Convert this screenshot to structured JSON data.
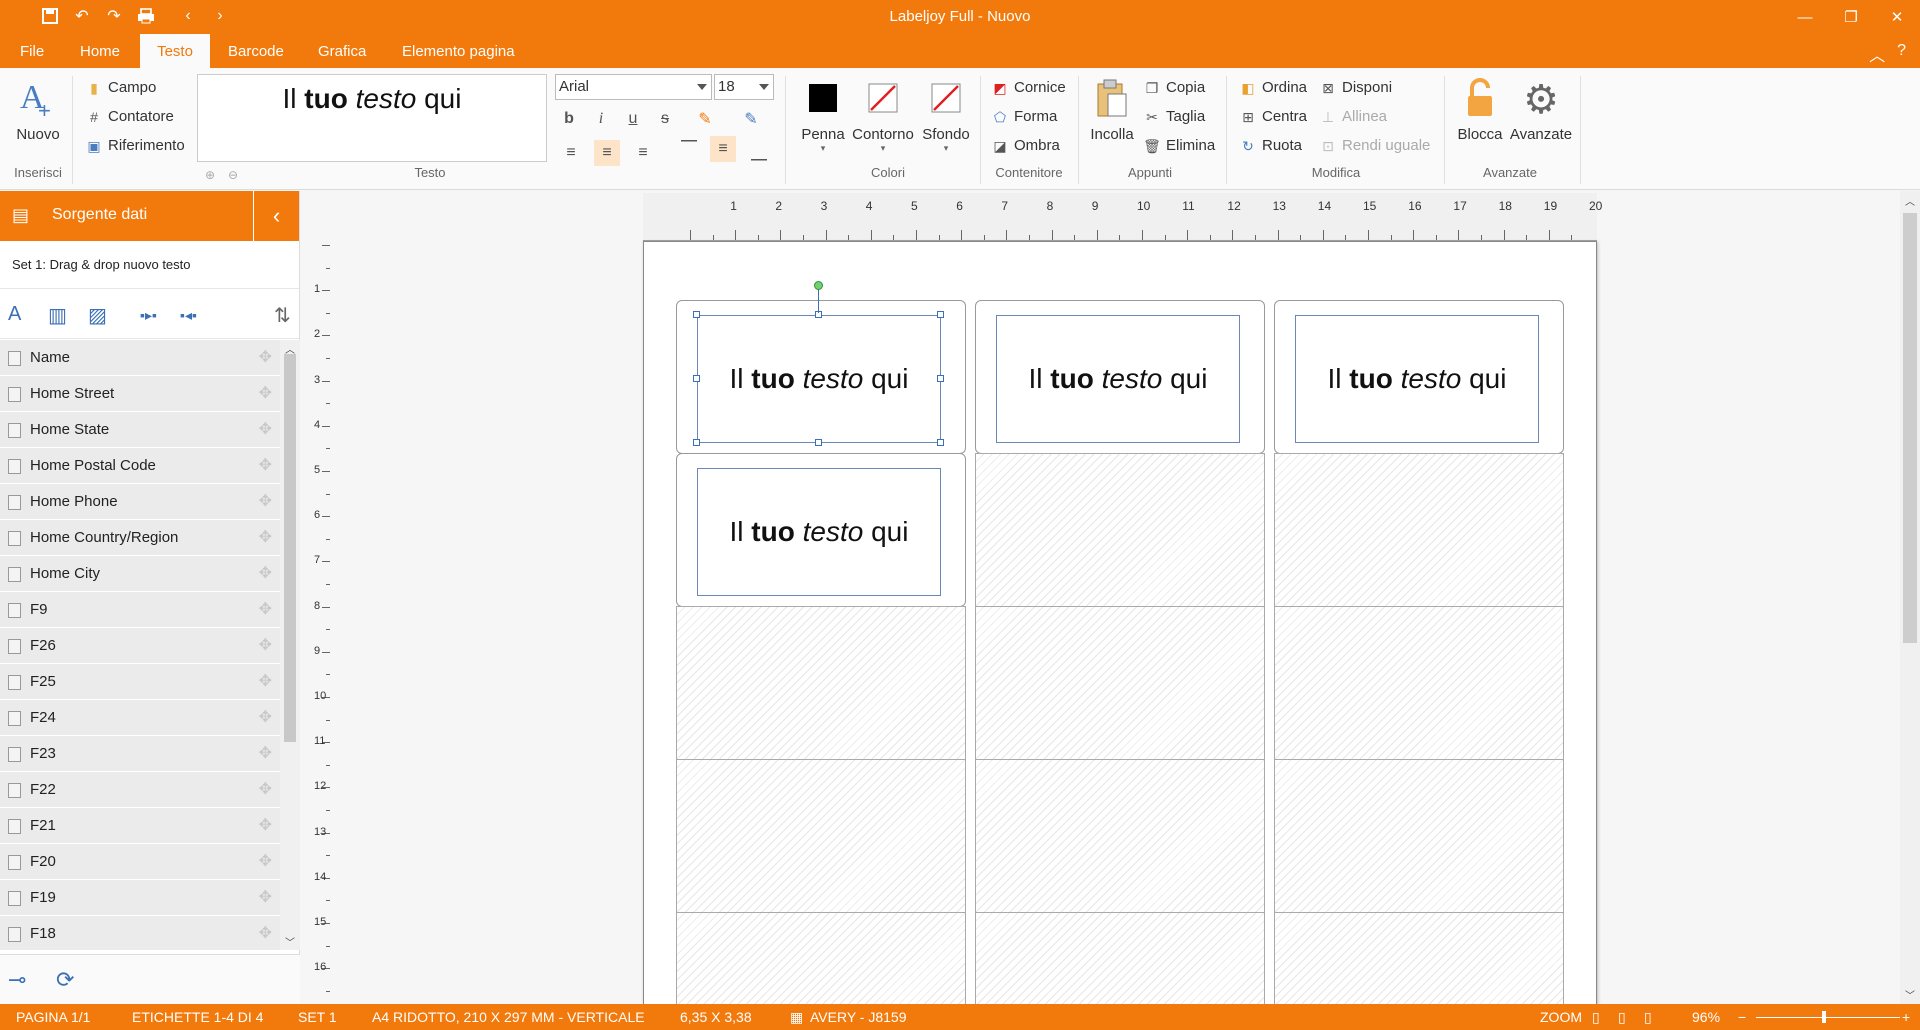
{
  "window": {
    "title": "Labeljoy Full - Nuovo"
  },
  "menu": {
    "tabs": [
      {
        "label": "File"
      },
      {
        "label": "Home"
      },
      {
        "label": "Testo"
      },
      {
        "label": "Barcode"
      },
      {
        "label": "Grafica"
      },
      {
        "label": "Elemento pagina"
      }
    ],
    "active": "Testo"
  },
  "ribbon": {
    "inserisci": {
      "new_label": "Nuovo",
      "group": "Inserisci"
    },
    "testo": {
      "campo": "Campo",
      "contatore": "Contatore",
      "riferimento": "Riferimento",
      "preview": {
        "a": "Il ",
        "b": "tuo",
        "c": " ",
        "d": "testo",
        "e": " qui"
      },
      "group": "Testo",
      "font": "Arial",
      "size": "18"
    },
    "colori": {
      "penna": "Penna",
      "contorno": "Contorno",
      "sfondo": "Sfondo",
      "group": "Colori"
    },
    "contenitore": {
      "cornice": "Cornice",
      "forma": "Forma",
      "ombra": "Ombra",
      "group": "Contenitore"
    },
    "appunti": {
      "incolla": "Incolla",
      "copia": "Copia",
      "taglia": "Taglia",
      "elimina": "Elimina",
      "group": "Appunti"
    },
    "modifica": {
      "ordina": "Ordina",
      "disponi": "Disponi",
      "centra": "Centra",
      "allinea": "Allinea",
      "ruota": "Ruota",
      "rendi_uguale": "Rendi uguale",
      "group": "Modifica"
    },
    "avanzate": {
      "blocca": "Blocca",
      "avanzate": "Avanzate",
      "group": "Avanzate"
    }
  },
  "left_panel": {
    "title": "Sorgente dati",
    "set_label": "Set 1: Drag & drop nuovo testo",
    "fields": [
      "Name",
      "Home Street",
      "Home State",
      "Home Postal Code",
      "Home Phone",
      "Home Country/Region",
      "Home City",
      "F9",
      "F26",
      "F25",
      "F24",
      "F23",
      "F22",
      "F21",
      "F20",
      "F19",
      "F18"
    ]
  },
  "rulers": {
    "h": [
      "1",
      "2",
      "3",
      "4",
      "5",
      "6",
      "7",
      "8",
      "9",
      "10",
      "11",
      "12",
      "13",
      "14",
      "15",
      "16",
      "17",
      "18",
      "19",
      "20"
    ],
    "v": [
      "1",
      "2",
      "3",
      "4",
      "5",
      "6",
      "7",
      "8",
      "9",
      "10",
      "11",
      "12",
      "13",
      "14",
      "15",
      "16"
    ]
  },
  "labels": {
    "text": {
      "a": "Il ",
      "b": "tuo",
      "c": " ",
      "d": "testo",
      "e": " qui"
    }
  },
  "status": {
    "page": "PAGINA 1/1",
    "labels": "ETICHETTE 1-4 DI 4",
    "set": "SET 1",
    "format": "A4 RIDOTTO, 210 X 297 MM - VERTICALE",
    "size": "6,35 X 3,38",
    "template": "AVERY - J8159",
    "zoom_label": "ZOOM",
    "zoom_value": "96%"
  },
  "colors": {
    "accent": "#f27a0c"
  }
}
